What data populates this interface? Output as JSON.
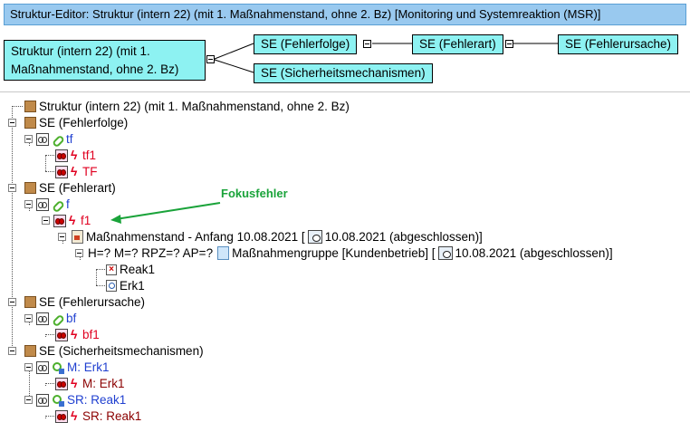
{
  "window": {
    "title": "Struktur-Editor: Struktur (intern 22) (mit 1. Maßnahmenstand, ohne 2. Bz) [Monitoring und Systemreaktion (MSR)]"
  },
  "diagram": {
    "root": "Struktur (intern 22) (mit 1. Maßnahmenstand, ohne 2. Bz)",
    "se_fehlerfolge": "SE (Fehlerfolge)",
    "se_fehlerart": "SE (Fehlerart)",
    "se_fehlerursache": "SE (Fehlerursache)",
    "se_sicherheit": "SE (Sicherheitsmechanismen)"
  },
  "tree": {
    "root_label": "Struktur (intern 22) (mit 1. Maßnahmenstand, ohne 2. Bz)",
    "fehlerfolge": {
      "label": "SE (Fehlerfolge)",
      "function": "tf",
      "failures": [
        "tf1",
        "TF"
      ]
    },
    "fehlerart": {
      "label": "SE (Fehlerart)",
      "function": "f",
      "failure": "f1",
      "measure_state": "Maßnahmenstand - Anfang 10.08.2021",
      "measure_state_date": "10.08.2021 (abgeschlossen)]",
      "rating": "H=? M=? RPZ=? AP=?",
      "measure_group": "Maßnahmengruppe [Kundenbetrieb]",
      "measure_group_date": "10.08.2021 (abgeschlossen)]",
      "actions": [
        "Reak1",
        "Erk1"
      ]
    },
    "fehlerursache": {
      "label": "SE (Fehlerursache)",
      "function": "bf",
      "failure": "bf1"
    },
    "sicherheit": {
      "label": "SE (Sicherheitsmechanismen)",
      "m_function": "M: Erk1",
      "m_failure": "M: Erk1",
      "sr_function": "SR: Reak1",
      "sr_failure": "SR: Reak1"
    }
  },
  "annotation": {
    "text": "Fokusfehler",
    "color": "#1aa33a"
  },
  "icons": {
    "structure_element": "brown-square-icon",
    "function": "link-icon",
    "failure": "lightning-icon",
    "toggle": "eye-toggle-icon"
  }
}
